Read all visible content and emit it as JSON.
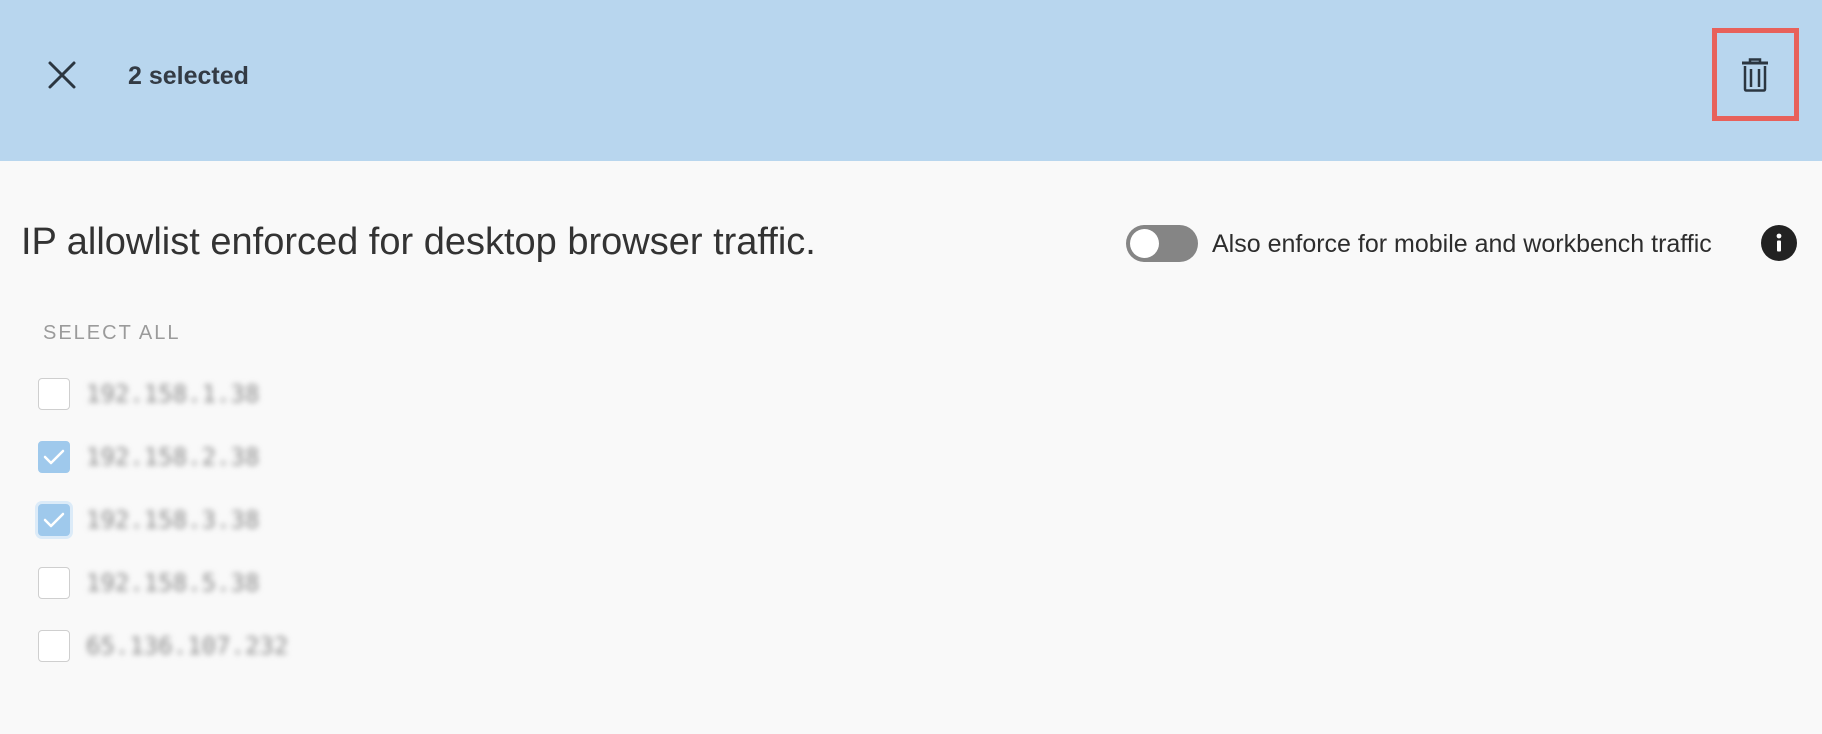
{
  "selection_bar": {
    "selected_label": "2 selected",
    "close_icon": "close-icon",
    "delete_icon": "trash-icon",
    "background": "#b8d6ee",
    "highlight_color": "#e8615a"
  },
  "main": {
    "heading": "IP allowlist enforced for desktop browser traffic.",
    "toggle": {
      "label": "Also enforce for mobile and workbench traffic",
      "state": "off"
    },
    "info_icon": "info-icon",
    "select_all_label": "SELECT ALL",
    "ip_list": [
      {
        "address": "192.158.1.38",
        "checked": false
      },
      {
        "address": "192.158.2.38",
        "checked": true
      },
      {
        "address": "192.158.3.38",
        "checked": true
      },
      {
        "address": "192.158.5.38",
        "checked": false
      },
      {
        "address": "65.136.107.232",
        "checked": false
      }
    ]
  }
}
